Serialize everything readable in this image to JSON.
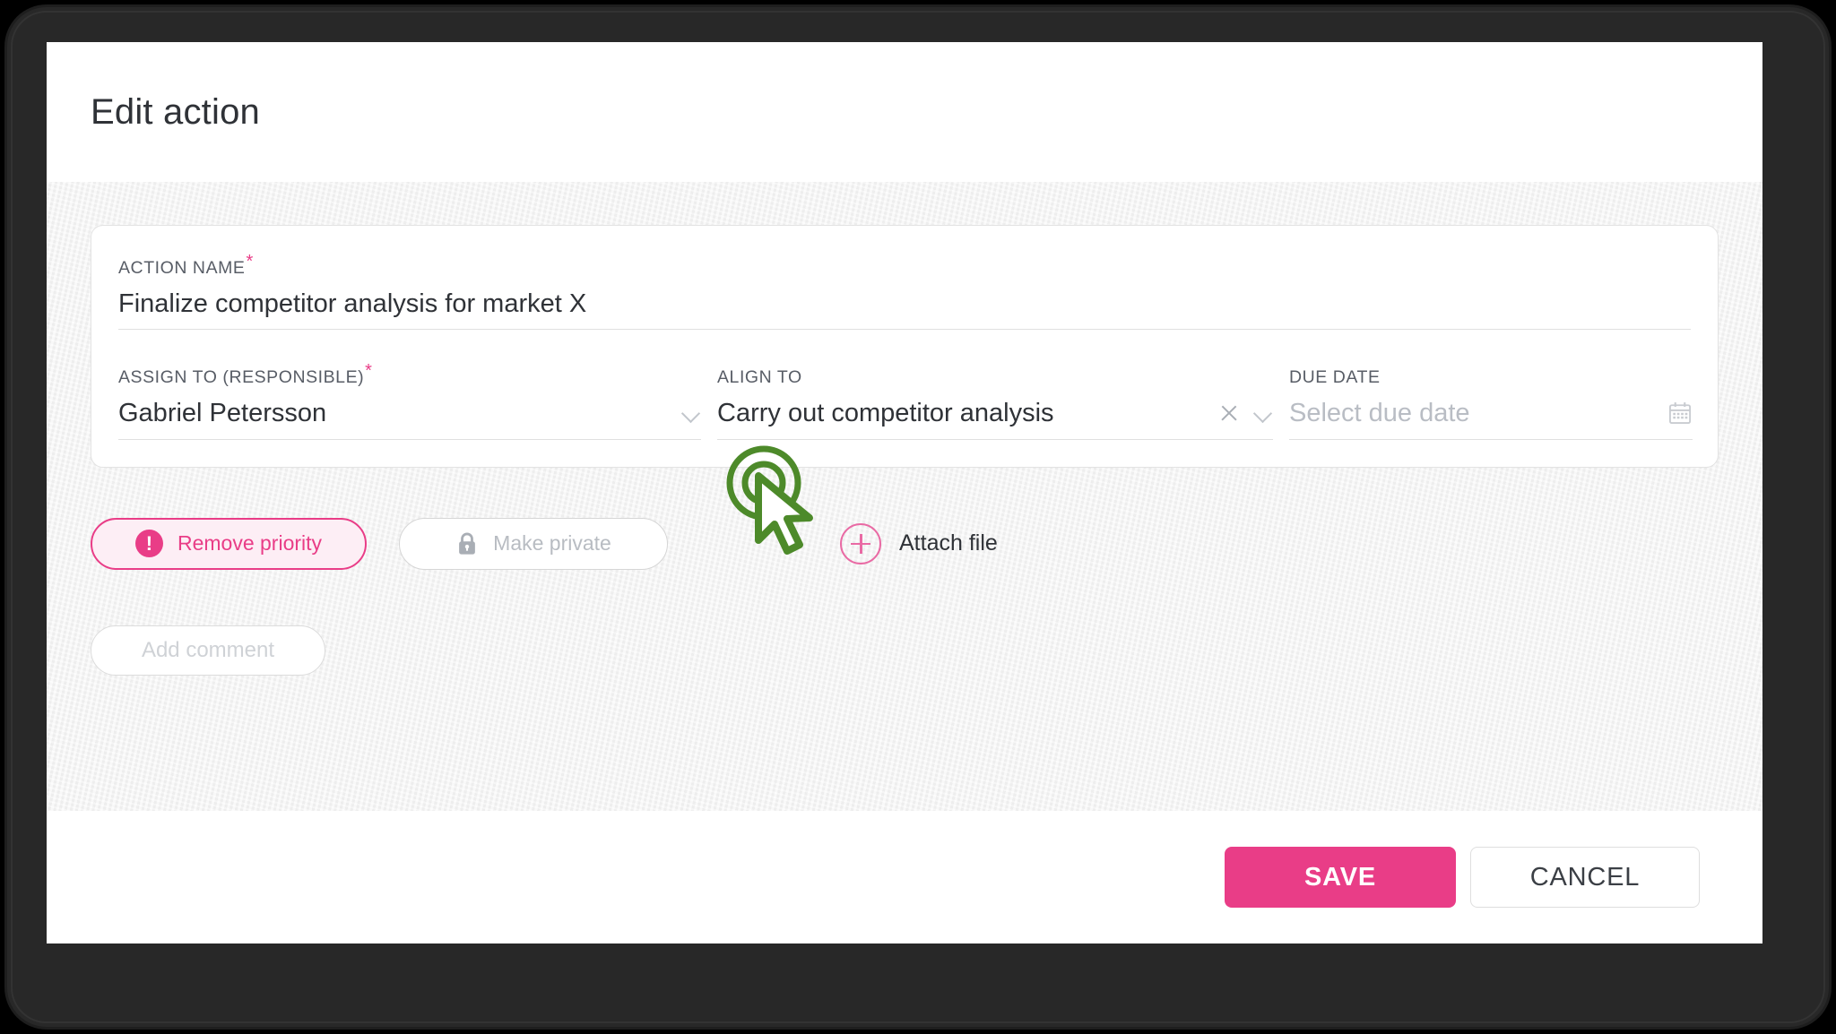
{
  "dialog": {
    "title": "Edit action"
  },
  "form": {
    "action_name": {
      "label": "ACTION NAME",
      "required": true,
      "value": "Finalize competitor analysis for market X"
    },
    "assign_to": {
      "label": "ASSIGN TO (RESPONSIBLE)",
      "required": true,
      "value": "Gabriel Petersson",
      "chevron_icon": "chevron-down-icon"
    },
    "align_to": {
      "label": "ALIGN TO",
      "required": false,
      "value": "Carry out competitor analysis",
      "clear_icon": "close-x-icon",
      "chevron_icon": "chevron-down-icon"
    },
    "due_date": {
      "label": "DUE DATE",
      "required": false,
      "value": "",
      "placeholder": "Select due date",
      "calendar_icon": "calendar-icon"
    },
    "required_marker": "*"
  },
  "actions": {
    "remove_priority": {
      "label": "Remove priority",
      "icon": "exclamation-circle-icon",
      "glyph": "!"
    },
    "make_private": {
      "label": "Make private",
      "icon": "lock-icon"
    },
    "attach_file": {
      "label": "Attach file",
      "icon": "plus-circle-icon"
    },
    "add_comment": {
      "label": "Add comment"
    }
  },
  "footer": {
    "save_label": "SAVE",
    "cancel_label": "CANCEL"
  },
  "cursor": {
    "icon": "click-pointer-icon",
    "color": "#4d8a2a"
  },
  "colors": {
    "accent_pink": "#e93d87",
    "accent_pink_soft": "#fdeef5",
    "text_primary": "#2f3237",
    "text_muted": "#b8bcc2",
    "body_background": "#f3f3f3",
    "bezel": "#282828"
  }
}
